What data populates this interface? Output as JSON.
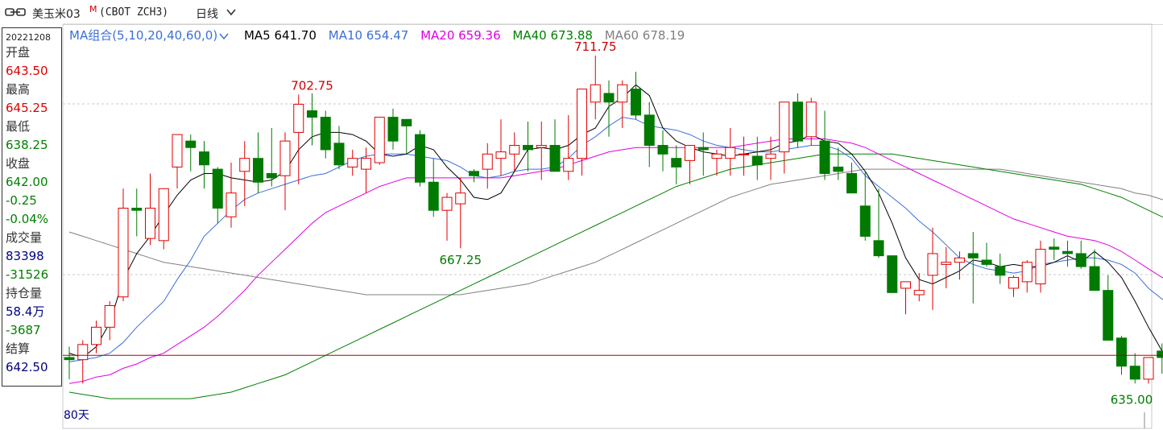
{
  "header": {
    "contract_name": "美玉米03",
    "contract_flag": "M",
    "contract_code": "(CBOT ZCH3)",
    "period": "日线"
  },
  "info_panel": {
    "date": "20221208",
    "open_label": "开盘",
    "open": "643.50",
    "high_label": "最高",
    "high": "645.25",
    "low_label": "最低",
    "low": "638.25",
    "close_label": "收盘",
    "close": "642.00",
    "change": "-0.25",
    "change_pct": "-0.04%",
    "volume_label": "成交量",
    "volume": "83398",
    "volume_change": "-31526",
    "oi_label": "持仓量",
    "oi": "58.4万",
    "oi_change": "-3687",
    "settle_label": "结算",
    "settle": "642.50"
  },
  "legend": {
    "group": "MA组合(5,10,20,40,60,0)",
    "ma5": "MA5 641.70",
    "ma10": "MA10 654.47",
    "ma20": "MA20 659.36",
    "ma40": "MA40 673.88",
    "ma60": "MA60 678.19"
  },
  "days_label": "80天",
  "colors": {
    "up": "#e00000",
    "down": "#007a00",
    "ma5": "#000000",
    "ma10": "#3a6fd8",
    "ma20": "#e000e0",
    "ma40": "#008000",
    "ma60": "#808080",
    "refline": "#b00000"
  },
  "chart_data": {
    "type": "candlestick",
    "ylim": [
      626,
      719
    ],
    "annotations": [
      {
        "text": "711.75",
        "kind": "high",
        "bar": 39,
        "value": 711.75
      },
      {
        "text": "702.75",
        "kind": "high",
        "bar": 18,
        "value": 702.75
      },
      {
        "text": "667.25",
        "kind": "low",
        "bar": 29,
        "value": 667.25
      },
      {
        "text": "635.00",
        "kind": "low",
        "bar": 82,
        "value": 635.0
      }
    ],
    "reference_line": 642.5,
    "ohlc": [
      [
        642.0,
        644.5,
        637.0,
        641.5
      ],
      [
        641.5,
        646.0,
        636.0,
        645.0
      ],
      [
        645.0,
        650.5,
        643.0,
        649.0
      ],
      [
        649.0,
        655.0,
        646.0,
        654.0
      ],
      [
        656.0,
        681.0,
        655.0,
        676.5
      ],
      [
        676.5,
        681.0,
        670.0,
        676.0
      ],
      [
        669.5,
        684.5,
        668.0,
        676.5
      ],
      [
        669.0,
        681.0,
        667.0,
        681.0
      ],
      [
        686.0,
        693.5,
        681.0,
        693.5
      ],
      [
        692.0,
        693.5,
        685.0,
        690.5
      ],
      [
        689.5,
        692.0,
        681.0,
        686.5
      ],
      [
        685.5,
        686.0,
        673.0,
        676.5
      ],
      [
        674.5,
        687.0,
        672.0,
        680.0
      ],
      [
        685.0,
        692.0,
        677.0,
        688.0
      ],
      [
        688.0,
        694.0,
        680.0,
        682.5
      ],
      [
        684.5,
        695.0,
        681.5,
        683.5
      ],
      [
        684.0,
        694.0,
        676.0,
        692.0
      ],
      [
        694.0,
        702.75,
        682.0,
        700.5
      ],
      [
        699.0,
        703.0,
        691.0,
        697.5
      ],
      [
        697.5,
        699.0,
        688.0,
        690.0
      ],
      [
        691.5,
        695.5,
        685.5,
        686.5
      ],
      [
        686.0,
        690.0,
        684.0,
        688.0
      ],
      [
        685.5,
        690.5,
        680.0,
        688.0
      ],
      [
        687.0,
        697.0,
        686.5,
        697.5
      ],
      [
        697.5,
        699.5,
        690.0,
        692.0
      ],
      [
        697.0,
        696.5,
        689.0,
        695.5
      ],
      [
        693.5,
        694.5,
        681.5,
        682.5
      ],
      [
        682.5,
        688.0,
        674.5,
        676.0
      ],
      [
        676.0,
        680.0,
        669.0,
        679.0
      ],
      [
        677.5,
        683.5,
        667.25,
        680.0
      ],
      [
        685.0,
        685.5,
        682.5,
        684.0
      ],
      [
        685.5,
        691.5,
        681.0,
        689.0
      ],
      [
        688.0,
        697.0,
        684.0,
        689.5
      ],
      [
        689.0,
        694.0,
        685.0,
        691.0
      ],
      [
        691.0,
        696.5,
        685.0,
        690.0
      ],
      [
        690.5,
        696.5,
        683.0,
        691.0
      ],
      [
        691.0,
        697.0,
        685.5,
        685.0
      ],
      [
        685.0,
        698.0,
        683.0,
        688.0
      ],
      [
        688.0,
        698.0,
        684.0,
        704.0
      ],
      [
        701.0,
        711.75,
        697.0,
        705.0
      ],
      [
        703.0,
        706.0,
        693.0,
        701.0
      ],
      [
        701.0,
        706.0,
        695.0,
        705.0
      ],
      [
        704.0,
        708.0,
        697.0,
        698.0
      ],
      [
        698.0,
        701.0,
        686.0,
        691.0
      ],
      [
        691.0,
        694.5,
        685.0,
        689.0
      ],
      [
        688.0,
        691.0,
        682.0,
        686.0
      ],
      [
        687.5,
        691.0,
        682.0,
        691.0
      ],
      [
        690.5,
        694.0,
        684.0,
        690.0
      ],
      [
        688.0,
        690.0,
        684.0,
        689.0
      ],
      [
        688.0,
        695.0,
        684.0,
        690.5
      ],
      [
        689.0,
        693.0,
        684.0,
        689.0
      ],
      [
        688.5,
        693.0,
        683.0,
        686.5
      ],
      [
        688.0,
        693.0,
        683.0,
        689.0
      ],
      [
        689.5,
        697.0,
        684.5,
        701.0
      ],
      [
        701.0,
        703.0,
        690.5,
        692.0
      ],
      [
        693.0,
        702.0,
        691.0,
        701.0
      ],
      [
        692.0,
        699.0,
        683.0,
        684.5
      ],
      [
        686.0,
        690.5,
        683.0,
        685.0
      ],
      [
        684.5,
        687.0,
        680.0,
        680.0
      ],
      [
        677.0,
        685.0,
        669.0,
        670.0
      ],
      [
        669.0,
        681.0,
        665.0,
        665.5
      ],
      [
        665.5,
        665.5,
        657.0,
        657.0
      ],
      [
        658.0,
        659.0,
        652.0,
        659.5
      ],
      [
        656.5,
        661.5,
        655.0,
        657.5
      ],
      [
        661.0,
        672.0,
        653.0,
        666.0
      ],
      [
        663.5,
        667.5,
        658.0,
        664.0
      ],
      [
        664.0,
        666.5,
        660.0,
        665.0
      ],
      [
        666.0,
        671.0,
        654.5,
        665.0
      ],
      [
        664.5,
        668.5,
        663.0,
        663.5
      ],
      [
        663.0,
        666.0,
        659.0,
        661.0
      ],
      [
        658.0,
        661.0,
        656.0,
        660.5
      ],
      [
        659.5,
        664.5,
        657.0,
        664.0
      ],
      [
        659.0,
        669.0,
        657.0,
        667.0
      ],
      [
        667.5,
        669.5,
        664.5,
        667.0
      ],
      [
        666.5,
        669.0,
        663.0,
        666.0
      ],
      [
        666.0,
        669.0,
        662.5,
        663.0
      ],
      [
        663.0,
        667.0,
        659.0,
        657.5
      ],
      [
        657.5,
        661.0,
        652.0,
        646.0
      ],
      [
        646.5,
        647.0,
        638.0,
        640.0
      ],
      [
        640.0,
        643.0,
        636.0,
        637.0
      ],
      [
        637.0,
        641.5,
        636.0,
        642.0
      ],
      [
        643.5,
        645.25,
        638.25,
        642.0
      ]
    ],
    "ma": {
      "MA5": [
        643.0,
        642.0,
        644.5,
        650.0,
        660.0,
        666.0,
        670.0,
        675.0,
        679.5,
        683.0,
        684.5,
        684.5,
        683.5,
        683.0,
        682.5,
        683.0,
        685.0,
        690.0,
        693.0,
        694.0,
        694.0,
        693.5,
        692.0,
        689.0,
        688.5,
        689.0,
        691.0,
        690.0,
        686.0,
        683.0,
        679.0,
        678.5,
        680.0,
        685.0,
        690.0,
        690.5,
        690.0,
        691.0,
        693.5,
        695.0,
        700.0,
        702.0,
        705.0,
        702.5,
        695.0,
        692.0,
        690.5,
        689.5,
        689.0,
        688.5,
        689.0,
        689.5,
        690.0,
        691.5,
        692.0,
        693.5,
        692.0,
        691.5,
        689.0,
        685.0,
        680.0,
        673.0,
        665.0,
        660.0,
        659.0,
        660.5,
        662.0,
        664.5,
        664.0,
        663.0,
        663.5,
        663.0,
        663.0,
        664.0,
        665.5,
        664.0,
        666.5,
        664.0,
        660.5,
        655.0,
        649.0,
        643.5,
        641.7
      ],
      "MA10": [
        641.0,
        641.5,
        642.0,
        643.0,
        645.5,
        649.0,
        652.0,
        655.0,
        660.0,
        664.5,
        670.0,
        673.0,
        676.0,
        678.5,
        680.0,
        681.0,
        682.0,
        683.0,
        684.0,
        684.5,
        686.0,
        687.5,
        688.5,
        689.0,
        689.0,
        689.0,
        688.5,
        688.0,
        687.5,
        686.0,
        684.0,
        683.5,
        684.0,
        685.0,
        685.5,
        685.5,
        686.0,
        688.0,
        691.0,
        693.0,
        695.5,
        697.5,
        697.0,
        695.5,
        695.0,
        694.5,
        693.5,
        692.0,
        691.0,
        690.5,
        690.0,
        689.5,
        689.5,
        690.0,
        690.5,
        691.0,
        691.0,
        690.0,
        688.0,
        684.0,
        681.5,
        679.0,
        676.5,
        673.5,
        671.0,
        668.0,
        665.0,
        663.5,
        662.5,
        662.0,
        661.5,
        662.0,
        663.5,
        664.0,
        664.5,
        665.0,
        665.0,
        664.5,
        663.5,
        661.5,
        658.0,
        655.5,
        654.5
      ],
      "MA20": [
        636.0,
        636.5,
        637.5,
        638.0,
        639.5,
        640.5,
        642.0,
        643.0,
        645.0,
        647.0,
        649.0,
        651.5,
        654.5,
        657.5,
        661.0,
        664.0,
        667.0,
        670.0,
        673.0,
        675.5,
        677.0,
        678.5,
        680.0,
        681.5,
        682.5,
        683.5,
        683.5,
        683.5,
        683.5,
        683.5,
        683.5,
        683.5,
        683.5,
        684.0,
        684.5,
        685.0,
        685.5,
        686.5,
        687.5,
        688.5,
        689.5,
        690.0,
        690.5,
        690.5,
        690.5,
        690.5,
        690.5,
        690.5,
        690.5,
        690.5,
        691.0,
        691.5,
        692.0,
        692.5,
        692.5,
        692.5,
        692.5,
        692.0,
        691.5,
        690.5,
        689.0,
        687.5,
        686.0,
        684.5,
        683.0,
        681.5,
        680.0,
        678.5,
        677.0,
        675.5,
        674.0,
        673.0,
        672.0,
        671.0,
        670.0,
        669.5,
        669.0,
        668.0,
        666.5,
        664.5,
        662.5,
        660.5,
        659.4
      ],
      "MA40": [
        634.0,
        633.5,
        633.0,
        632.5,
        632.5,
        632.5,
        632.5,
        632.5,
        632.5,
        632.5,
        633.0,
        633.5,
        634.0,
        635.0,
        636.0,
        637.0,
        638.0,
        639.5,
        641.0,
        642.5,
        644.0,
        645.5,
        647.0,
        648.5,
        650.0,
        651.5,
        653.0,
        654.5,
        656.0,
        657.5,
        659.0,
        660.5,
        662.0,
        663.5,
        665.0,
        666.5,
        668.0,
        669.5,
        671.0,
        672.5,
        674.0,
        675.5,
        677.0,
        678.5,
        680.0,
        681.5,
        682.5,
        683.5,
        684.5,
        685.5,
        686.0,
        686.5,
        687.0,
        687.5,
        688.0,
        688.5,
        689.0,
        689.0,
        689.0,
        689.0,
        689.0,
        689.0,
        688.5,
        688.0,
        687.5,
        687.0,
        686.5,
        686.0,
        685.5,
        685.0,
        684.5,
        684.0,
        683.5,
        683.0,
        682.5,
        682.0,
        681.0,
        680.0,
        679.0,
        677.5,
        676.0,
        674.5,
        673.9
      ],
      "MA60": [
        671.0,
        670.0,
        669.0,
        668.0,
        667.0,
        666.0,
        665.0,
        664.0,
        663.5,
        663.0,
        662.5,
        662.0,
        661.5,
        661.0,
        660.5,
        660.0,
        659.5,
        659.0,
        658.5,
        658.0,
        657.5,
        657.0,
        656.5,
        656.5,
        656.5,
        656.5,
        656.5,
        656.5,
        656.5,
        656.5,
        657.0,
        657.5,
        658.0,
        658.5,
        659.0,
        660.0,
        661.0,
        662.0,
        663.0,
        664.0,
        665.5,
        667.0,
        668.5,
        670.0,
        671.5,
        673.0,
        674.5,
        676.0,
        677.5,
        679.0,
        680.0,
        681.0,
        682.0,
        682.5,
        683.0,
        683.5,
        684.0,
        684.5,
        685.0,
        685.5,
        685.5,
        685.5,
        685.5,
        685.5,
        685.5,
        685.5,
        685.5,
        685.5,
        685.5,
        685.5,
        685.0,
        684.5,
        684.0,
        683.5,
        683.0,
        682.5,
        682.0,
        681.5,
        681.0,
        680.0,
        679.5,
        678.5,
        678.2
      ]
    }
  }
}
